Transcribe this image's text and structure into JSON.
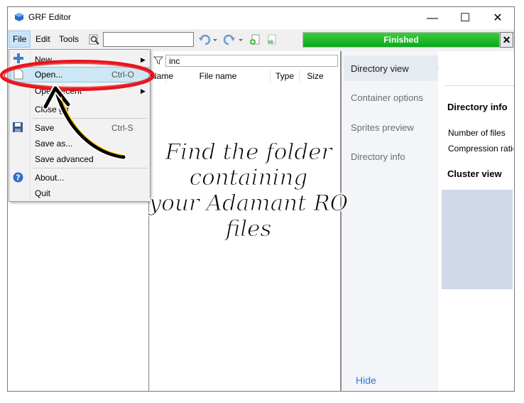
{
  "window": {
    "title": "GRF Editor",
    "minimize_glyph": "—",
    "maximize_glyph": "☐",
    "close_glyph": "✕"
  },
  "menu": {
    "file": "File",
    "edit": "Edit",
    "tools": "Tools"
  },
  "toolbar": {
    "search_value": "",
    "progress_label": "Finished",
    "progress_value": 1.0,
    "progress_close_glyph": "✕"
  },
  "file_list": {
    "filter_value": "inc",
    "columns": [
      "Name",
      "File name",
      "Type",
      "Size"
    ]
  },
  "tabs": [
    {
      "label": "Directory view",
      "selected": true
    },
    {
      "label": "Container options",
      "selected": false
    },
    {
      "label": "Sprites preview",
      "selected": false
    },
    {
      "label": "Directory info",
      "selected": false
    }
  ],
  "hide_label": "Hide",
  "directory_info": {
    "title": "Directory info",
    "number_of_files_label": "Number of files",
    "compression_ratio_label": "Compression ratio",
    "cluster_view_title": "Cluster view"
  },
  "file_menu": {
    "items": [
      {
        "label": "New",
        "shortcut": "",
        "submenu": true
      },
      {
        "label": "Open...",
        "shortcut": "Ctrl-O",
        "submenu": false
      },
      {
        "label": "Open recent",
        "shortcut": "",
        "submenu": true
      },
      {
        "label": "Close grf",
        "shortcut": "",
        "submenu": false
      },
      {
        "label": "Save",
        "shortcut": "Ctrl-S",
        "submenu": false
      },
      {
        "label": "Save as...",
        "shortcut": "",
        "submenu": false
      },
      {
        "label": "Save advanced",
        "shortcut": "",
        "submenu": false
      },
      {
        "label": "About...",
        "shortcut": "",
        "submenu": false
      },
      {
        "label": "Quit",
        "shortcut": "",
        "submenu": false
      }
    ]
  },
  "annotation": {
    "line1": "Find the folder containing",
    "line2": "your Adamant RO files",
    "ellipse_color": "#e8141c",
    "arrow_color": "#000000"
  },
  "colors": {
    "progress_green": "#0aa81d",
    "highlight": "#cce8f4",
    "link": "#2b79d0"
  }
}
